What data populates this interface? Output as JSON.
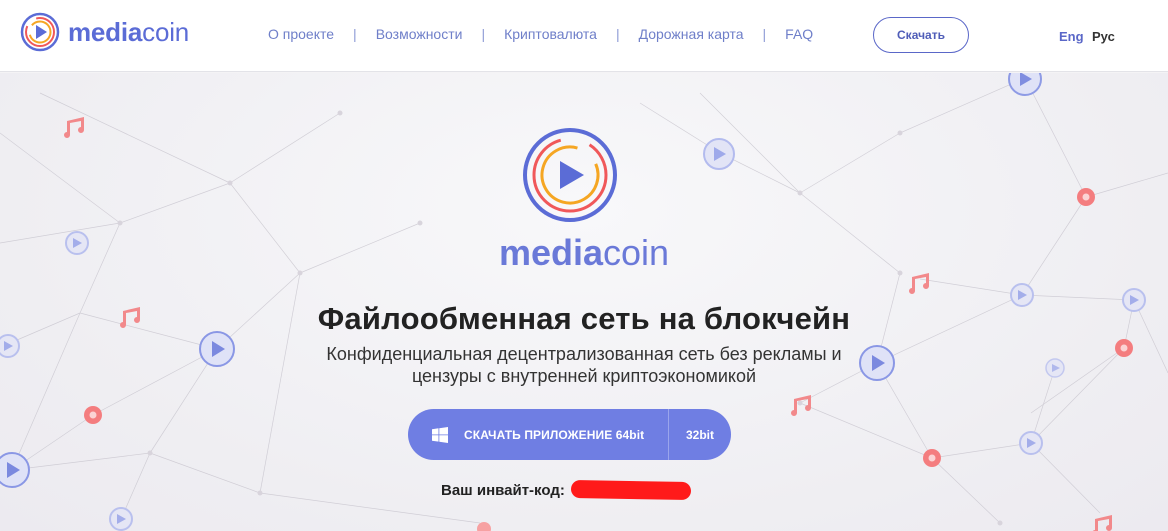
{
  "brand": {
    "part1": "media",
    "part2": "coin"
  },
  "nav": {
    "items": [
      {
        "label": "О проекте"
      },
      {
        "label": "Возможности"
      },
      {
        "label": "Криптовалюта"
      },
      {
        "label": "Дорожная карта"
      },
      {
        "label": "FAQ"
      }
    ],
    "separator": "|"
  },
  "header": {
    "download_label": "Скачать"
  },
  "lang": {
    "eng": "Eng",
    "rus": "Рус"
  },
  "hero": {
    "brand_part1": "media",
    "brand_part2": "coin",
    "title": "Файлообменная сеть на блокчейн",
    "subtitle": "Конфиденциальная децентрализованная сеть без рекламы и цензуры с внутренней криптоэкономикой",
    "download_64": "СКАЧАТЬ ПРИЛОЖЕНИЕ 64bit",
    "download_32": "32bit",
    "invite_label": "Ваш инвайт-код:"
  },
  "colors": {
    "brand": "#5b6cd6",
    "button": "#6f7ee3",
    "accent_red": "#f36b6b",
    "logo_ring_orange": "#f5a623",
    "logo_ring_red": "#f0585a"
  },
  "icons": {
    "windows": "windows-icon",
    "play": "play-icon",
    "note": "music-note-icon",
    "gear": "gear-icon"
  }
}
